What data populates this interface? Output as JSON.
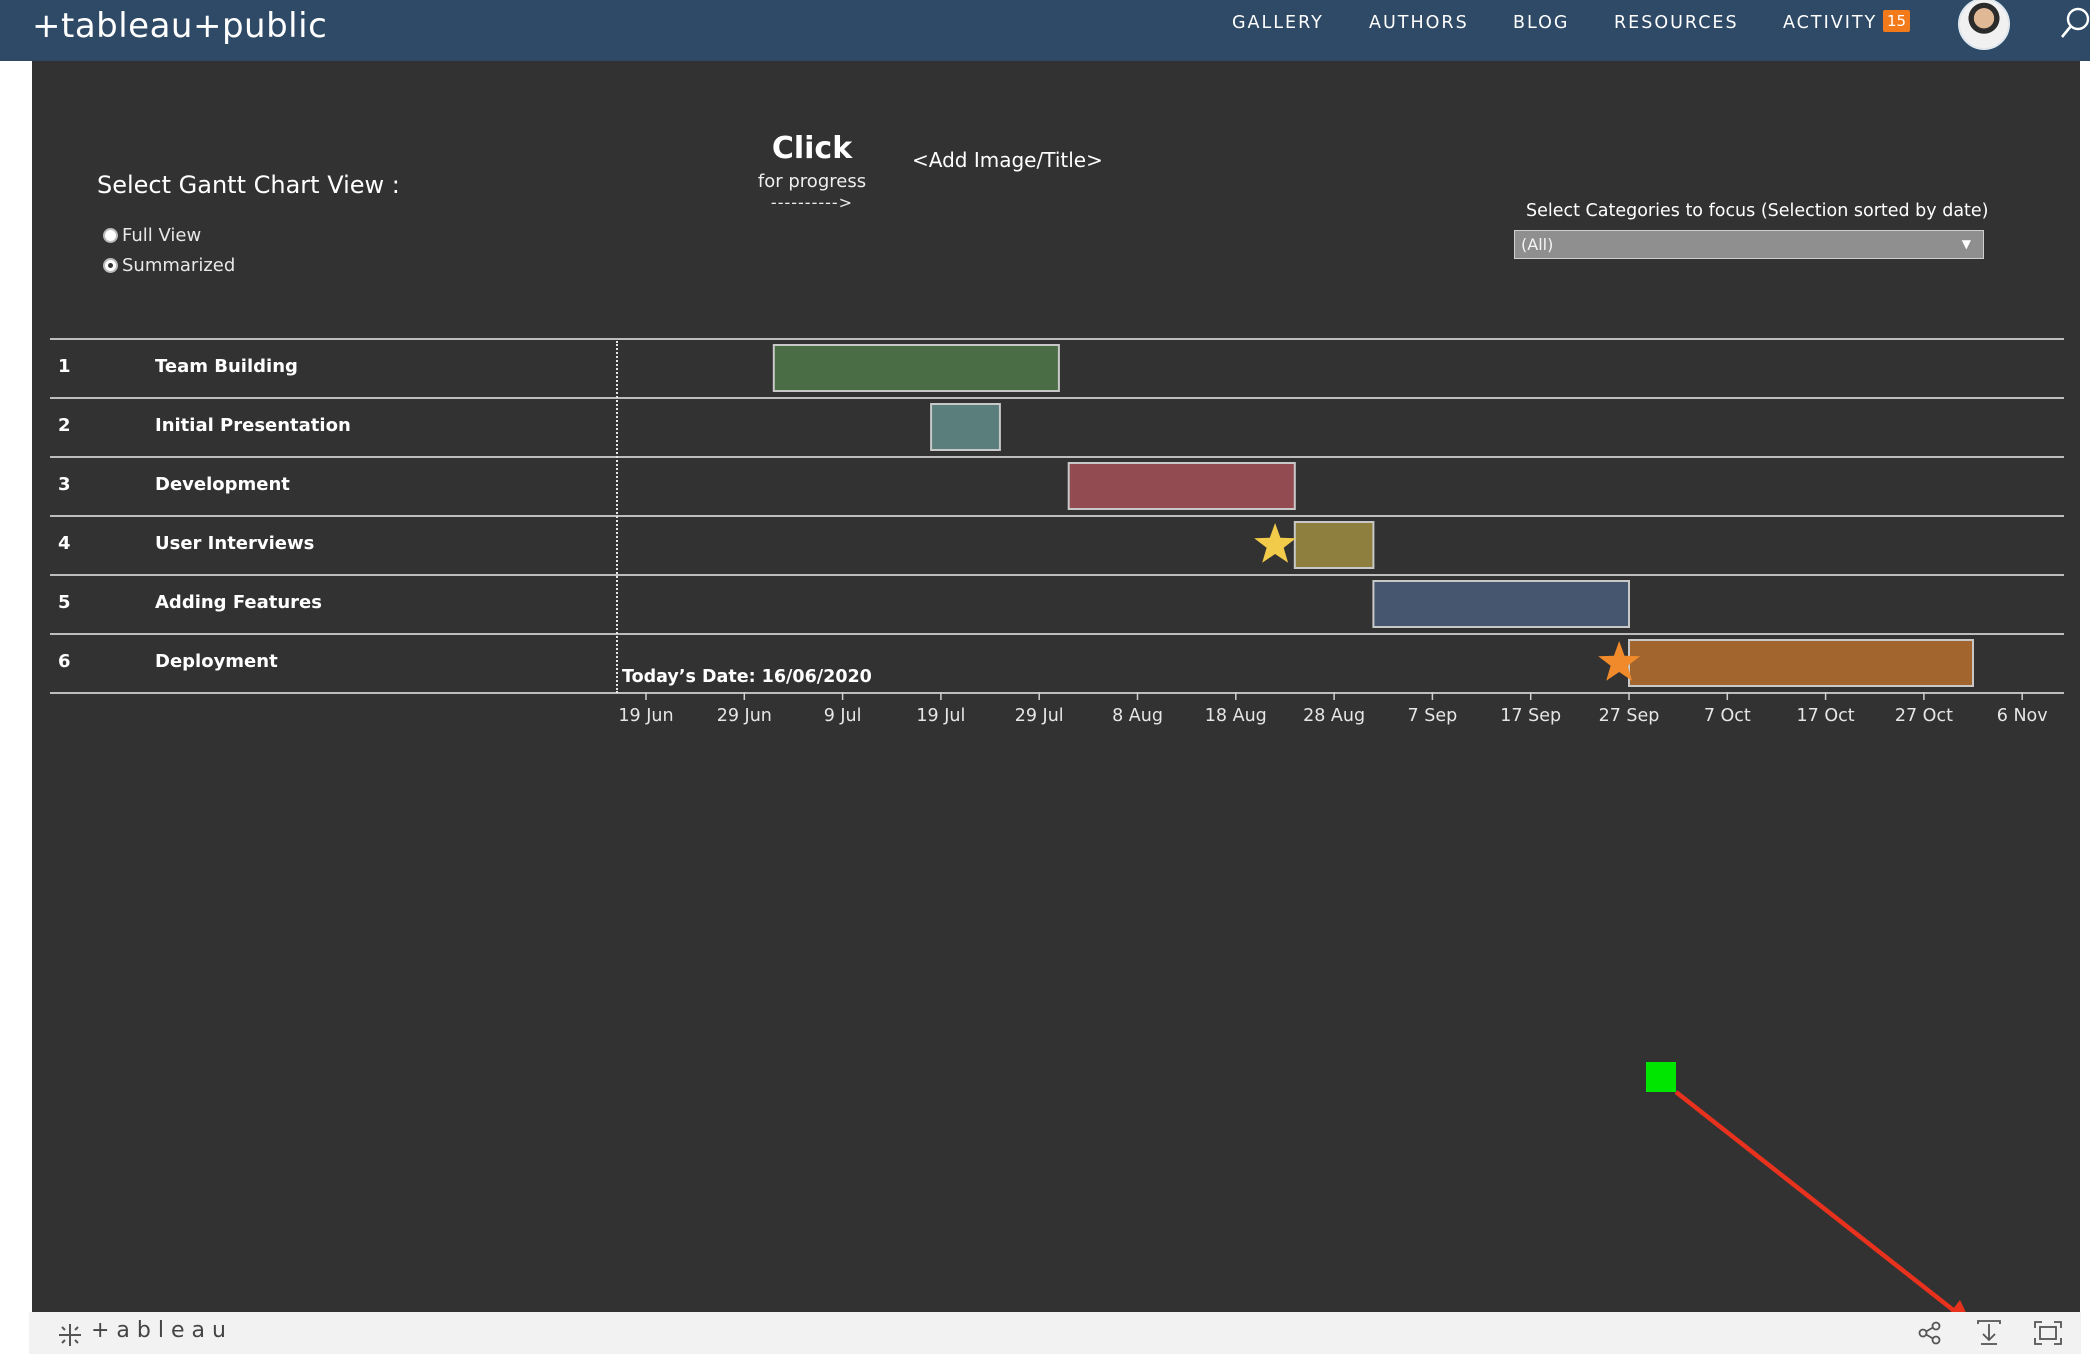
{
  "nav": {
    "logo": "+tableau+public",
    "items": [
      "GALLERY",
      "AUTHORS",
      "BLOG",
      "RESOURCES",
      "ACTIVITY"
    ],
    "activity_badge": "15",
    "icons": [
      "avatar",
      "search-icon"
    ]
  },
  "dashboard": {
    "view_selector": {
      "title": "Select Gantt Chart View :",
      "options": [
        "Full View",
        "Summarized"
      ],
      "selected": "Summarized"
    },
    "click_prompt": {
      "title": "Click",
      "subtitle": "for progress",
      "arrow": "---------->"
    },
    "add_image_title": "<Add Image/Title>",
    "category_filter": {
      "label": "Select Categories to focus (Selection sorted by date)",
      "value": "(All)"
    },
    "today_label": "Today’s Date: 16/06/2020",
    "colors": {
      "background": "#323232",
      "nav": "#2e4a66",
      "badge": "#f27a1a",
      "annotation_arrow": "#e8321e",
      "annotation_marker": "#00e600"
    }
  },
  "chart_data": {
    "type": "gantt",
    "x_axis": {
      "ticks": [
        "19 Jun",
        "29 Jun",
        "9 Jul",
        "19 Jul",
        "29 Jul",
        "8 Aug",
        "18 Aug",
        "28 Aug",
        "7 Sep",
        "17 Sep",
        "27 Sep",
        "7 Oct",
        "17 Oct",
        "27 Oct",
        "6 Nov"
      ]
    },
    "today": "2020-06-16",
    "tasks": [
      {
        "id": "1",
        "name": "Team Building",
        "start": "2020-07-02",
        "end": "2020-07-31",
        "color": "#4b6d46",
        "milestone": null
      },
      {
        "id": "2",
        "name": "Initial Presentation",
        "start": "2020-07-18",
        "end": "2020-07-25",
        "color": "#5a7e7c",
        "milestone": null
      },
      {
        "id": "3",
        "name": "Development",
        "start": "2020-08-01",
        "end": "2020-08-24",
        "color": "#934b52",
        "milestone": null
      },
      {
        "id": "4",
        "name": "User Interviews",
        "start": "2020-08-24",
        "end": "2020-09-01",
        "color": "#8e7f3e",
        "milestone": {
          "date": "2020-08-22",
          "color": "#f2cb4a"
        }
      },
      {
        "id": "5",
        "name": "Adding Features",
        "start": "2020-09-01",
        "end": "2020-09-27",
        "color": "#46566e",
        "milestone": null
      },
      {
        "id": "6",
        "name": "Deployment",
        "start": "2020-09-27",
        "end": "2020-11-01",
        "color": "#a2652d",
        "milestone": {
          "date": "2020-09-26",
          "color": "#f08a2a"
        }
      }
    ]
  },
  "footer": {
    "logo": "+ableau",
    "icons": [
      "share-icon",
      "download-icon",
      "fullscreen-icon"
    ]
  }
}
